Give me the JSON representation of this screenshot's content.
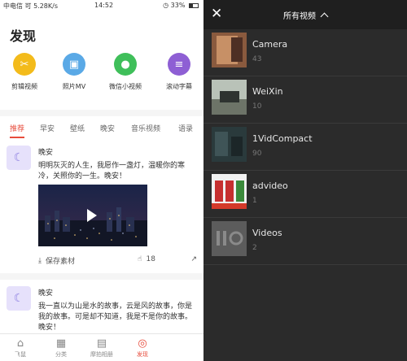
{
  "left": {
    "status": {
      "left": "中电信 可 5.28K/s",
      "time": "14:52",
      "battery": "33%"
    },
    "title": "发现",
    "tools": [
      {
        "label": "剪辑视频",
        "icon": "scissors-icon",
        "color": "#f3bb1b",
        "glyph": "✂"
      },
      {
        "label": "照片MV",
        "icon": "photo-icon",
        "color": "#5aa9e6",
        "glyph": "▣"
      },
      {
        "label": "微信小视频",
        "icon": "wechat-icon",
        "color": "#3fbf5a",
        "glyph": "●"
      },
      {
        "label": "滚动字幕",
        "icon": "subtitle-icon",
        "color": "#8e5fd4",
        "glyph": "≡"
      }
    ],
    "tabs": [
      "推荐",
      "早安",
      "壁纸",
      "晚安",
      "音乐视频",
      "语录"
    ],
    "active_tab": "推荐",
    "posts": [
      {
        "author": "晚安",
        "text": "明明灰灭的人生，我愿作一盏灯，温暖你的寒冷，关照你的一生。晚安！",
        "save_label": "保存素材",
        "likes": "18"
      },
      {
        "author": "晚安",
        "text": "我一直以为山是水的故事，云是风的故事，你是我的故事。可是却不知道，我是不是你的故事。晚安！"
      }
    ],
    "nav": [
      {
        "label": "飞鼠",
        "icon": "home-icon",
        "glyph": "⌂"
      },
      {
        "label": "分类",
        "icon": "grid-icon",
        "glyph": "▦"
      },
      {
        "label": "摩拍相册",
        "icon": "album-icon",
        "glyph": "▤"
      },
      {
        "label": "发现",
        "icon": "compass-icon",
        "glyph": "◎"
      }
    ],
    "active_nav": "发现",
    "accent": "#e74c3c"
  },
  "right": {
    "title": "所有视频",
    "albums": [
      {
        "name": "Camera",
        "count": "43"
      },
      {
        "name": "WeiXin",
        "count": "10"
      },
      {
        "name": "1VidCompact",
        "count": "90"
      },
      {
        "name": "advideo",
        "count": "1"
      },
      {
        "name": "Videos",
        "count": "2"
      }
    ]
  }
}
